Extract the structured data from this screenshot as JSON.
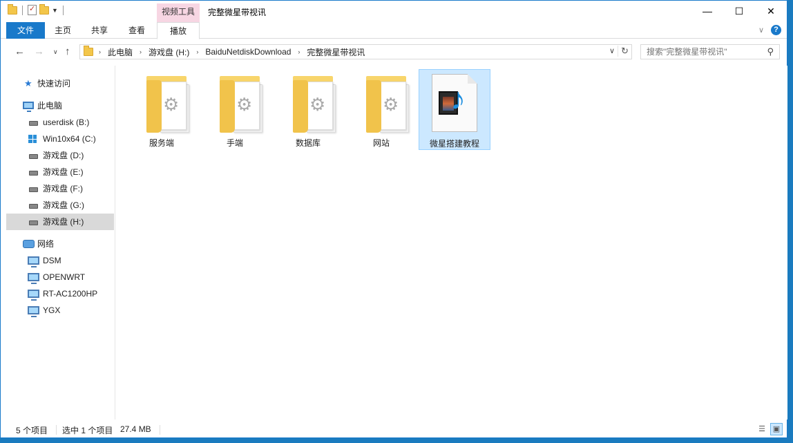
{
  "window": {
    "title": "完整微星带视讯",
    "context_tab_group": "视频工具",
    "controls": {
      "minimize": "—",
      "maximize": "☐",
      "close": "✕"
    }
  },
  "ribbon": {
    "tabs": [
      "文件",
      "主页",
      "共享",
      "查看",
      "播放"
    ],
    "collapse_icon": "chevron-down-icon",
    "help_label": "?"
  },
  "address": {
    "crumbs": [
      "此电脑",
      "游戏盘 (H:)",
      "BaiduNetdiskDownload",
      "完整微星带视讯"
    ]
  },
  "search": {
    "placeholder": "搜索\"完整微星带视讯\""
  },
  "nav_pane": {
    "quick_access": "快速访问",
    "this_pc": "此电脑",
    "drives": [
      "userdisk (B:)",
      "Win10x64 (C:)",
      "游戏盘 (D:)",
      "游戏盘 (E:)",
      "游戏盘 (F:)",
      "游戏盘 (G:)",
      "游戏盘 (H:)"
    ],
    "selected_drive": "游戏盘 (H:)",
    "network": "网络",
    "network_hosts": [
      "DSM",
      "OPENWRT",
      "RT-AC1200HP",
      "YGX"
    ]
  },
  "files": [
    {
      "name": "服务端",
      "type": "folder",
      "selected": false
    },
    {
      "name": "手端",
      "type": "folder",
      "selected": false
    },
    {
      "name": "数据库",
      "type": "folder",
      "selected": false
    },
    {
      "name": "网站",
      "type": "folder",
      "selected": false
    },
    {
      "name": "微星搭建教程",
      "type": "video",
      "selected": true
    }
  ],
  "status": {
    "item_count": "5 个项目",
    "selection": "选中 1 个项目",
    "size": "27.4 MB"
  },
  "colors": {
    "accent": "#1979ca",
    "context_tab": "#f7d6e3",
    "selection": "#cce8ff"
  }
}
